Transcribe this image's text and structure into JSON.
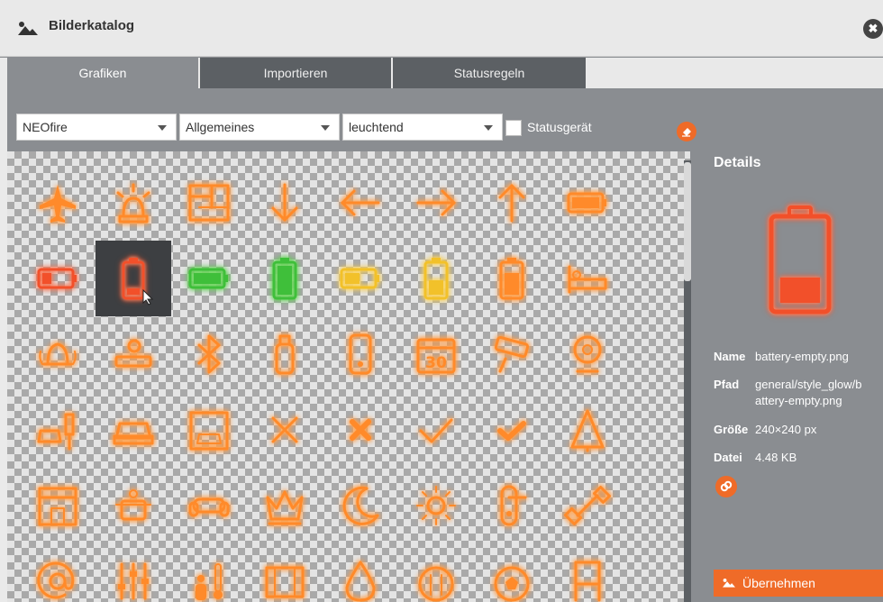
{
  "window": {
    "title": "Bilderkatalog",
    "close_label": "✖"
  },
  "tabs": [
    {
      "label": "Grafiken",
      "active": true
    },
    {
      "label": "Importieren",
      "active": false
    },
    {
      "label": "Statusregeln",
      "active": false
    }
  ],
  "filters": {
    "library": "NEOfire",
    "category": "Allgemeines",
    "style": "leuchtend",
    "status_device_label": "Statusgerät",
    "status_device_checked": false
  },
  "icons": [
    [
      "airplane",
      "siren",
      "floorplan",
      "arrow-down",
      "arrow-left",
      "arrow-right",
      "arrow-up",
      "battery-full-horizontal"
    ],
    [
      "battery-empty-horizontal-red",
      "battery-empty",
      "battery-full-horizontal-green",
      "battery-full-vertical-green",
      "battery-half-horizontal-yellow",
      "battery-half-vertical-yellow",
      "battery-vertical",
      "bed"
    ],
    [
      "bell",
      "projector",
      "bluetooth",
      "bottle",
      "phone",
      "calendar",
      "camera",
      "webcam"
    ],
    [
      "car-traffic-light",
      "car",
      "garage",
      "cross-thin",
      "cross-bold",
      "check-thin",
      "check-bold",
      "christmas-tree"
    ],
    [
      "shop",
      "cooking-pot",
      "sofa",
      "crown",
      "moon",
      "sun",
      "door-handle",
      "dumbbell"
    ],
    [
      "at-sign",
      "mixer",
      "thermometer-person",
      "frame",
      "fire",
      "restaurant",
      "soccer",
      "chair"
    ]
  ],
  "selected_icon": "battery-empty",
  "details": {
    "title": "Details",
    "name_label": "Name",
    "name_value": "battery-empty.png",
    "path_label": "Pfad",
    "path_value_line1": "general/style_glow/b",
    "path_value_line2": "attery-empty.png",
    "size_label": "Größe",
    "size_value": "240×240 px",
    "file_label": "Datei",
    "file_value": "4.48 KB",
    "apply_label": "Übernehmen"
  },
  "colors": {
    "accent": "#ef6b28",
    "glow_orange": "#ff8a2a",
    "glow_green": "#3fbf3a",
    "glow_yellow": "#f2c12a",
    "glow_red": "#f2502a",
    "panel": "#8a8d91"
  }
}
